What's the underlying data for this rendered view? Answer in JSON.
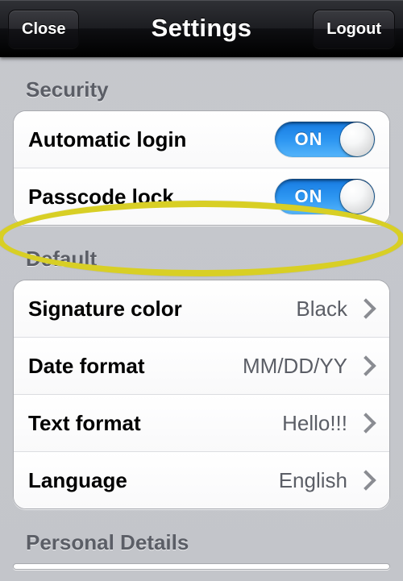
{
  "nav": {
    "close_label": "Close",
    "title": "Settings",
    "logout_label": "Logout"
  },
  "sections": {
    "security": {
      "header": "Security",
      "automatic_login": {
        "label": "Automatic login",
        "state": "ON"
      },
      "passcode_lock": {
        "label": "Passcode lock",
        "state": "ON"
      }
    },
    "default": {
      "header": "Default",
      "signature_color": {
        "label": "Signature color",
        "value": "Black"
      },
      "date_format": {
        "label": "Date format",
        "value": "MM/DD/YY"
      },
      "text_format": {
        "label": "Text format",
        "value": "Hello!!!"
      },
      "language": {
        "label": "Language",
        "value": "English"
      }
    },
    "personal_details": {
      "header": "Personal Details"
    }
  },
  "colors": {
    "accent_blue": "#2f98f2",
    "highlight": "#d8cf25"
  }
}
